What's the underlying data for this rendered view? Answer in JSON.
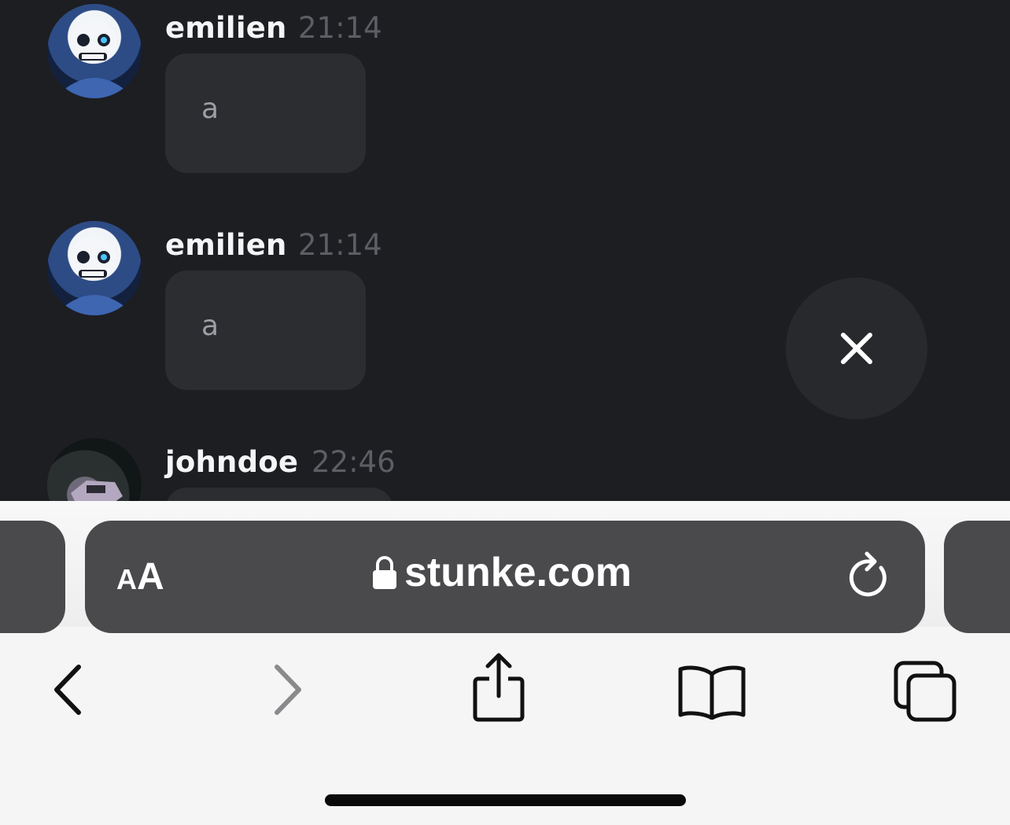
{
  "messages": [
    {
      "author": "emilien",
      "time": "21:14",
      "text": "a",
      "avatar": "sans-avatar"
    },
    {
      "author": "emilien",
      "time": "21:14",
      "text": "a",
      "avatar": "sans-avatar"
    },
    {
      "author": "johndoe",
      "time": "22:46",
      "text": "",
      "avatar": "car-avatar"
    }
  ],
  "browser": {
    "text_size_label_small": "A",
    "text_size_label_big": "A",
    "url": "stunke.com",
    "icons": {
      "lock": "lock-icon",
      "reload": "reload-icon",
      "back": "chevron-left-icon",
      "forward": "chevron-right-icon",
      "share": "share-icon",
      "bookmarks": "book-icon",
      "tabs": "tabs-icon",
      "close": "close-icon"
    }
  },
  "colors": {
    "chat_background": "#1d1e22",
    "bubble": "#2c2d31",
    "url_bar": "#4a4a4c"
  }
}
